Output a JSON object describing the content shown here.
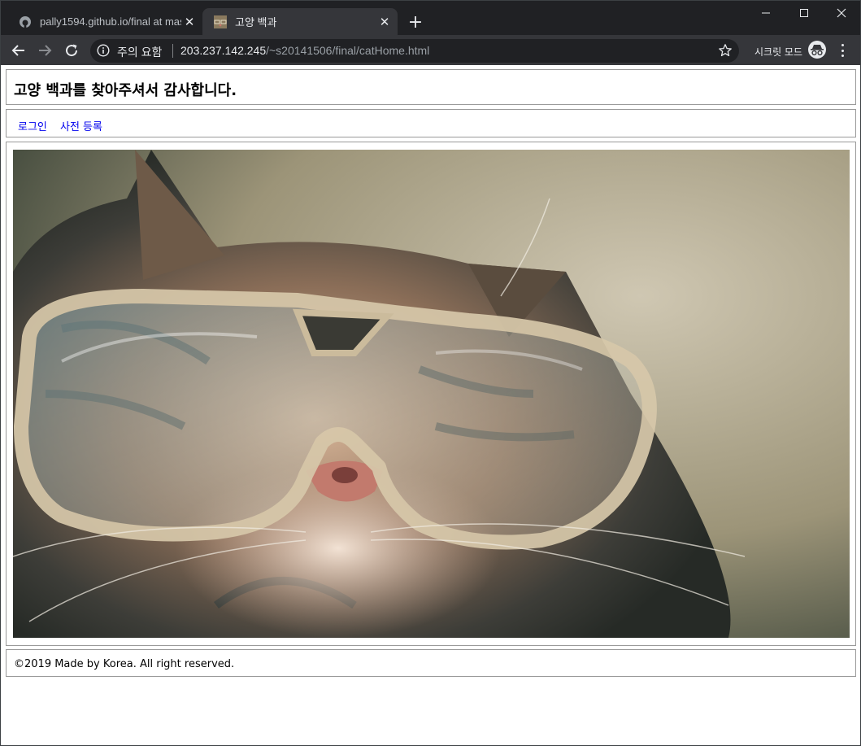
{
  "browser": {
    "tabs": [
      {
        "title": "pally1594.github.io/final at mast",
        "active": false,
        "icon": "github-icon"
      },
      {
        "title": "고양 백과",
        "active": true,
        "icon": "cat-favicon-icon"
      }
    ],
    "address": {
      "security_label": "주의 요함",
      "host": "203.237.142.245",
      "path": "/~s20141506/final/catHome.html"
    },
    "incognito_label": "시크릿 모드"
  },
  "page": {
    "heading": "고양 백과를 찾아주셔서 감사합니다.",
    "nav": [
      {
        "label": "로그인"
      },
      {
        "label": "사전 등록"
      }
    ],
    "image": {
      "subject": "cat-with-glasses"
    },
    "footer": "©2019 Made by Korea. All right reserved."
  },
  "colors": {
    "titlebar": "#202124",
    "toolbar": "#35363a",
    "link": "#0000ee",
    "border": "#9a9a9a"
  }
}
